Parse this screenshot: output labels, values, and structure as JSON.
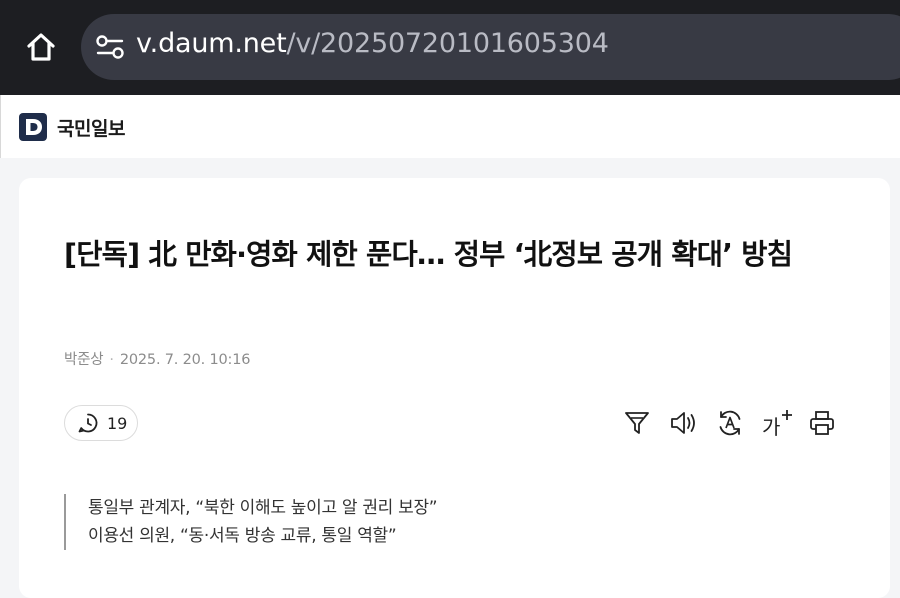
{
  "browser": {
    "url_host": "v.daum.net",
    "url_path": "/v/20250720101605304"
  },
  "site": {
    "press_name": "국민일보"
  },
  "article": {
    "headline": "[단독] 北 만화·영화 제한 푼다… 정부 ‘北정보 공개 확대’ 방침",
    "author": "박준상",
    "separator": "·",
    "date": "2025. 7. 20. 10:16",
    "comment_count": "19",
    "font_size_label": "가",
    "summary": [
      "통일부 관계자, “북한 이해도 높이고 알 권리 보장”",
      "이용선 의원, “동·서독 방송 교류, 통일 역할”"
    ]
  },
  "colors": {
    "browser_bg": "#1d1e22",
    "url_field_bg": "#383a44",
    "page_bg": "#f4f5f7",
    "card_bg": "#ffffff"
  }
}
